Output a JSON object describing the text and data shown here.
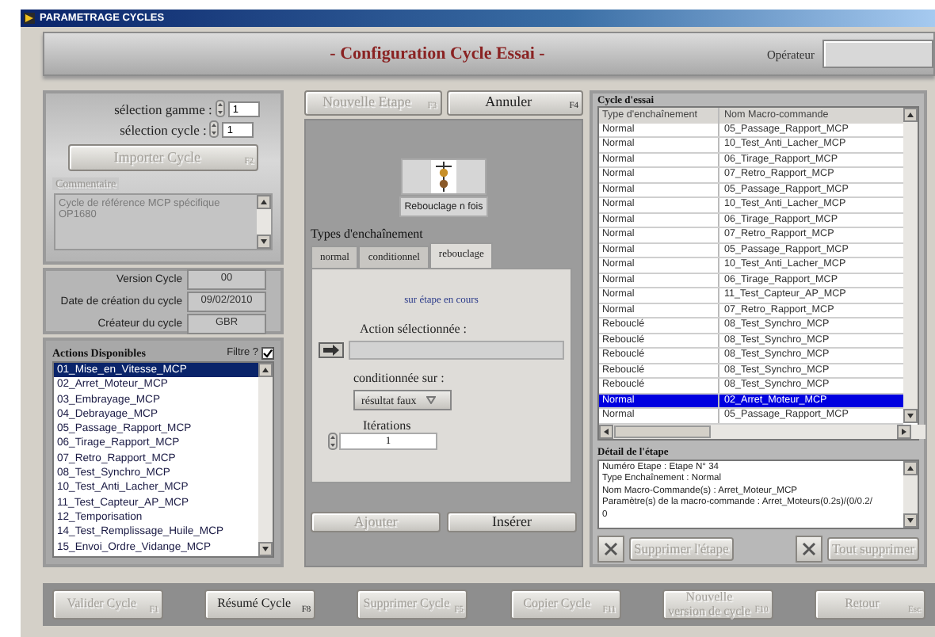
{
  "window": {
    "title": "PARAMETRAGE CYCLES"
  },
  "header": {
    "title": "- Configuration Cycle Essai -",
    "operator_label": "Opérateur"
  },
  "selection": [
    {
      "label": "sélection gamme :",
      "value": "1"
    },
    {
      "label": "sélection cycle :",
      "value": "1"
    }
  ],
  "import_button": {
    "label": "Importer Cycle",
    "shortcut": "F2",
    "disabled": true
  },
  "comment": {
    "label": "Commentaire",
    "text": "Cycle de référence MCP spécifique OP1680"
  },
  "info": [
    {
      "label": "Version Cycle",
      "value": "00"
    },
    {
      "label": "Date de création du cycle",
      "value": "09/02/2010"
    },
    {
      "label": "Créateur du cycle",
      "value": "GBR"
    }
  ],
  "actions": {
    "title": "Actions Disponibles",
    "filter_label": "Filtre ?",
    "filter_checked": true,
    "items": [
      {
        "label": "01_Mise_en_Vitesse_MCP",
        "selected": true
      },
      {
        "label": "02_Arret_Moteur_MCP",
        "selected": false
      },
      {
        "label": "03_Embrayage_MCP",
        "selected": false
      },
      {
        "label": "04_Debrayage_MCP",
        "selected": false
      },
      {
        "label": "05_Passage_Rapport_MCP",
        "selected": false
      },
      {
        "label": "06_Tirage_Rapport_MCP",
        "selected": false
      },
      {
        "label": "07_Retro_Rapport_MCP",
        "selected": false
      },
      {
        "label": "08_Test_Synchro_MCP",
        "selected": false
      },
      {
        "label": "10_Test_Anti_Lacher_MCP",
        "selected": false
      },
      {
        "label": "11_Test_Capteur_AP_MCP",
        "selected": false
      },
      {
        "label": "12_Temporisation",
        "selected": false
      },
      {
        "label": "14_Test_Remplissage_Huile_MCP",
        "selected": false
      },
      {
        "label": "15_Envoi_Ordre_Vidange_MCP",
        "selected": false
      }
    ]
  },
  "step_buttons": [
    {
      "label": "Nouvelle Etape",
      "shortcut": "F3",
      "disabled": true
    },
    {
      "label": "Annuler",
      "shortcut": "F4",
      "disabled": false
    }
  ],
  "step_caption": "Rebouclage n fois",
  "chain_types": {
    "label": "Types d'enchaînement",
    "tabs": [
      {
        "label": "normal",
        "selected": false
      },
      {
        "label": "conditionnel",
        "selected": false
      },
      {
        "label": "rebouclage",
        "selected": true
      }
    ],
    "loop_target": "sur étape en cours",
    "action_label": "Action sélectionnée :",
    "condition_label": "conditionnée sur :",
    "condition_value": "résultat faux",
    "iterations_label": "Itérations",
    "iterations_value": "1"
  },
  "edit_buttons": [
    {
      "label": "Ajouter",
      "disabled": true
    },
    {
      "label": "Insérer",
      "disabled": false
    }
  ],
  "cycle_table": {
    "title": "Cycle d'essai",
    "columns": [
      "Type d'enchaînement",
      "Nom Macro-commande"
    ],
    "rows": [
      {
        "cells": [
          "Normal",
          "05_Passage_Rapport_MCP"
        ],
        "selected": false
      },
      {
        "cells": [
          "Normal",
          "10_Test_Anti_Lacher_MCP"
        ],
        "selected": false
      },
      {
        "cells": [
          "Normal",
          "06_Tirage_Rapport_MCP"
        ],
        "selected": false
      },
      {
        "cells": [
          "Normal",
          "07_Retro_Rapport_MCP"
        ],
        "selected": false
      },
      {
        "cells": [
          "Normal",
          "05_Passage_Rapport_MCP"
        ],
        "selected": false
      },
      {
        "cells": [
          "Normal",
          "10_Test_Anti_Lacher_MCP"
        ],
        "selected": false
      },
      {
        "cells": [
          "Normal",
          "06_Tirage_Rapport_MCP"
        ],
        "selected": false
      },
      {
        "cells": [
          "Normal",
          "07_Retro_Rapport_MCP"
        ],
        "selected": false
      },
      {
        "cells": [
          "Normal",
          "05_Passage_Rapport_MCP"
        ],
        "selected": false
      },
      {
        "cells": [
          "Normal",
          "10_Test_Anti_Lacher_MCP"
        ],
        "selected": false
      },
      {
        "cells": [
          "Normal",
          "06_Tirage_Rapport_MCP"
        ],
        "selected": false
      },
      {
        "cells": [
          "Normal",
          "11_Test_Capteur_AP_MCP"
        ],
        "selected": false
      },
      {
        "cells": [
          "Normal",
          "07_Retro_Rapport_MCP"
        ],
        "selected": false
      },
      {
        "cells": [
          "Rebouclé",
          "08_Test_Synchro_MCP"
        ],
        "selected": false
      },
      {
        "cells": [
          "Rebouclé",
          "08_Test_Synchro_MCP"
        ],
        "selected": false
      },
      {
        "cells": [
          "Rebouclé",
          "08_Test_Synchro_MCP"
        ],
        "selected": false
      },
      {
        "cells": [
          "Rebouclé",
          "08_Test_Synchro_MCP"
        ],
        "selected": false
      },
      {
        "cells": [
          "Rebouclé",
          "08_Test_Synchro_MCP"
        ],
        "selected": false
      },
      {
        "cells": [
          "Normal",
          "02_Arret_Moteur_MCP"
        ],
        "selected": true
      },
      {
        "cells": [
          "Normal",
          "05_Passage_Rapport_MCP"
        ],
        "selected": false
      }
    ]
  },
  "detail": {
    "title": "Détail de l'étape",
    "lines": [
      "Numéro Etape : Etape N° 34",
      "Type Enchaînement : Normal",
      "Nom Macro-Commande(s) : Arret_Moteur_MCP",
      "Paramètre(s) de la macro-commande : Arret_Moteurs(0.2s)/(0/0.2/",
      "0"
    ]
  },
  "detail_buttons": [
    {
      "label": "Supprimer l'étape",
      "disabled": true
    },
    {
      "label": "Tout supprimer",
      "disabled": true
    }
  ],
  "footer_buttons": [
    {
      "label": "Valider Cycle",
      "shortcut": "F1",
      "disabled": true
    },
    {
      "label": "Résumé Cycle",
      "shortcut": "F8",
      "disabled": false
    },
    {
      "label": "Supprimer Cycle",
      "shortcut": "F5",
      "disabled": true
    },
    {
      "label": "Copier Cycle",
      "shortcut": "F11",
      "disabled": true
    },
    {
      "label": "Nouvelle version de cycle",
      "shortcut": "F10",
      "disabled": true
    },
    {
      "label": "Retour",
      "shortcut": "Esc",
      "disabled": true
    }
  ]
}
